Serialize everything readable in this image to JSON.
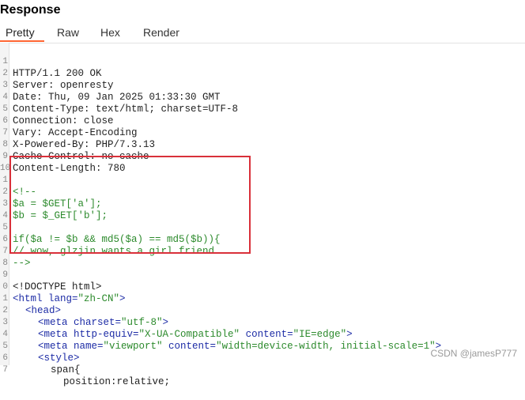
{
  "panel": {
    "title": "Response"
  },
  "tabs": [
    {
      "label": "Pretty",
      "active": true
    },
    {
      "label": "Raw",
      "active": false
    },
    {
      "label": "Hex",
      "active": false
    },
    {
      "label": "Render",
      "active": false
    }
  ],
  "colors": {
    "accent": "#ff6633",
    "highlight_box": "#d9303a",
    "comment_green": "#2c8a2c",
    "tag_blue": "#1c2ba5"
  },
  "lines": [
    {
      "n": "1",
      "text": "HTTP/1.1 200 OK"
    },
    {
      "n": "2",
      "name": "Server:",
      "value": " openresty"
    },
    {
      "n": "3",
      "name": "Date:",
      "value": " Thu, 09 Jan 2025 01:33:30 GMT"
    },
    {
      "n": "4",
      "name": "Content-Type:",
      "value": " text/html; charset=UTF-8"
    },
    {
      "n": "5",
      "name": "Connection:",
      "value": " close"
    },
    {
      "n": "6",
      "name": "Vary:",
      "value": " Accept-Encoding"
    },
    {
      "n": "7",
      "name": "X-Powered-By:",
      "value": " PHP/7.3.13"
    },
    {
      "n": "8",
      "name": "Cache-Control:",
      "value": " no-cache"
    },
    {
      "n": "9",
      "name": "Content-Length:",
      "value": " 780"
    },
    {
      "n": "10",
      "text": ""
    },
    {
      "n": "1",
      "text": "<!--"
    },
    {
      "n": "2",
      "text": "$a = $GET['a'];"
    },
    {
      "n": "3",
      "text": "$b = $_GET['b'];"
    },
    {
      "n": "4",
      "text": ""
    },
    {
      "n": "5",
      "text": "if($a != $b && md5($a) == md5($b)){"
    },
    {
      "n": "6",
      "text": "// wow, glzjin wants a girl friend."
    },
    {
      "n": "7",
      "text": "-->"
    },
    {
      "n": "8",
      "text": ""
    },
    {
      "n": "9",
      "text": "<!DOCTYPE html>"
    },
    {
      "n": "0",
      "t1": "<html ",
      "a1": "lang=",
      "v1": "\"zh-CN\"",
      "t2": ">"
    },
    {
      "n": "1",
      "text": "<head>"
    },
    {
      "n": "2",
      "t1": "<meta ",
      "a1": "charset=",
      "v1": "\"utf-8\"",
      "t2": ">"
    },
    {
      "n": "3",
      "t1": "<meta ",
      "a1": "http-equiv=",
      "v1": "\"X-UA-Compatible\"",
      "a2": " content=",
      "v2": "\"IE=edge\"",
      "t2": ">"
    },
    {
      "n": "4",
      "t1": "<meta ",
      "a1": "name=",
      "v1": "\"viewport\"",
      "a2": " content=",
      "v2": "\"width=device-width, initial-scale=1\"",
      "t2": ">"
    },
    {
      "n": "5",
      "text": "<style>"
    },
    {
      "n": "6",
      "text": "span{"
    },
    {
      "n": "7",
      "text": "position:relative;"
    }
  ],
  "watermark": "CSDN @jamesP777"
}
